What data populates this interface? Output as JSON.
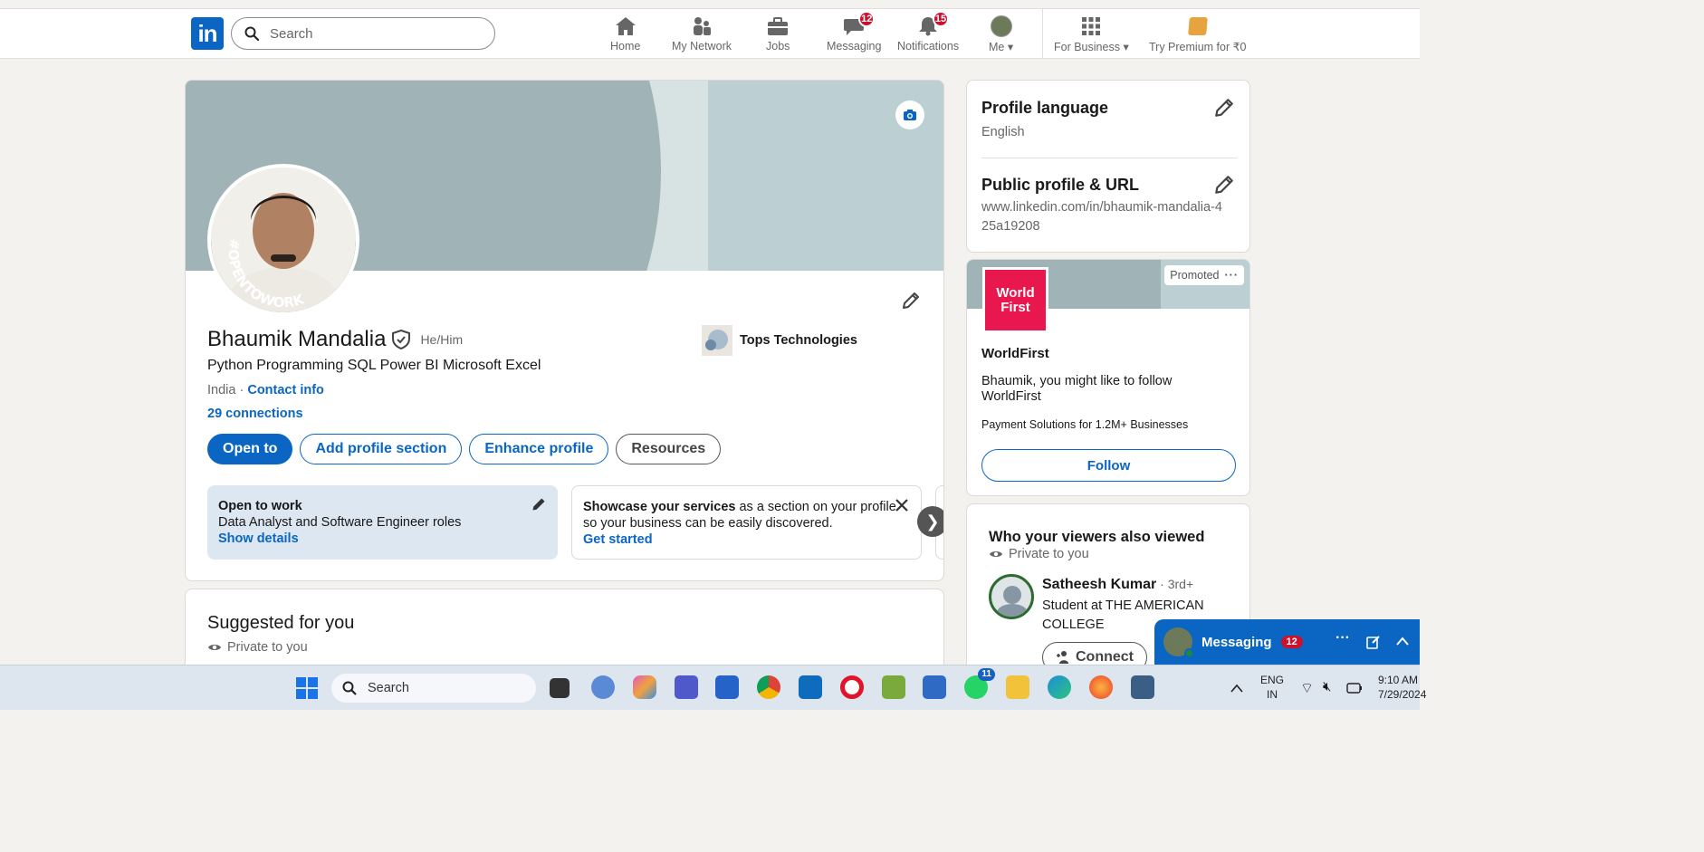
{
  "nav": {
    "search_placeholder": "Search",
    "items": [
      {
        "label": "Home",
        "icon": "home-icon"
      },
      {
        "label": "My Network",
        "icon": "network-icon"
      },
      {
        "label": "Jobs",
        "icon": "briefcase-icon"
      },
      {
        "label": "Messaging",
        "icon": "messaging-icon",
        "badge": "12"
      },
      {
        "label": "Notifications",
        "icon": "bell-icon",
        "badge": "15"
      },
      {
        "label": "Me",
        "icon": "avatar"
      },
      {
        "label": "For Business",
        "icon": "grid-icon"
      },
      {
        "label": "Try Premium for ₹0",
        "icon": "premium-icon"
      }
    ],
    "logo_text": "in"
  },
  "profile": {
    "name": "Bhaumik Mandalia",
    "pronouns": "He/Him",
    "headline": "Python Programming SQL Power BI Microsoft Excel",
    "location": "India",
    "location_sep": " · ",
    "contact_info": "Contact info",
    "connections": "29 connections",
    "company": "Tops Technologies",
    "open_to_work_ring": "#OPENTOWORK",
    "buttons": {
      "open_to": "Open to",
      "add_section": "Add profile section",
      "enhance": "Enhance profile",
      "resources": "Resources"
    },
    "otw_card": {
      "title": "Open to work",
      "roles": "Data Analyst and Software Engineer roles",
      "link": "Show details"
    },
    "showcase_card": {
      "bold": "Showcase your services",
      "text": " as a section on your profile so your business can be easily discovered.",
      "link": "Get started"
    }
  },
  "suggested": {
    "title": "Suggested for you",
    "privacy": "Private to you"
  },
  "side": {
    "profile_language_title": "Profile language",
    "profile_language_value": "English",
    "public_profile_title": "Public profile & URL",
    "public_profile_url": "www.linkedin.com/in/bhaumik-mandalia-425a19208",
    "ad": {
      "promoted": "Promoted",
      "logo_text": "World First",
      "company": "WorldFirst",
      "message": "Bhaumik, you might like to follow WorldFirst",
      "tagline": "Payment Solutions for 1.2M+ Businesses",
      "follow": "Follow"
    },
    "viewers": {
      "title": "Who your viewers also viewed",
      "privacy": "Private to you",
      "person_name": "Satheesh Kumar",
      "person_degree": " · 3rd+",
      "person_headline": "Student at THE AMERICAN COLLEGE",
      "connect": "Connect"
    }
  },
  "messaging_dock": {
    "title": "Messaging",
    "badge": "12"
  },
  "taskbar": {
    "search": "Search",
    "lang_top": "ENG",
    "lang_bottom": "IN",
    "time": "9:10 AM",
    "date": "7/29/2024",
    "whatsapp_badge": "11"
  },
  "colors": {
    "brand": "#0a66c2",
    "badge": "#cb112d",
    "otw_green": "#2d6b31",
    "worldfirst": "#e8184f"
  }
}
